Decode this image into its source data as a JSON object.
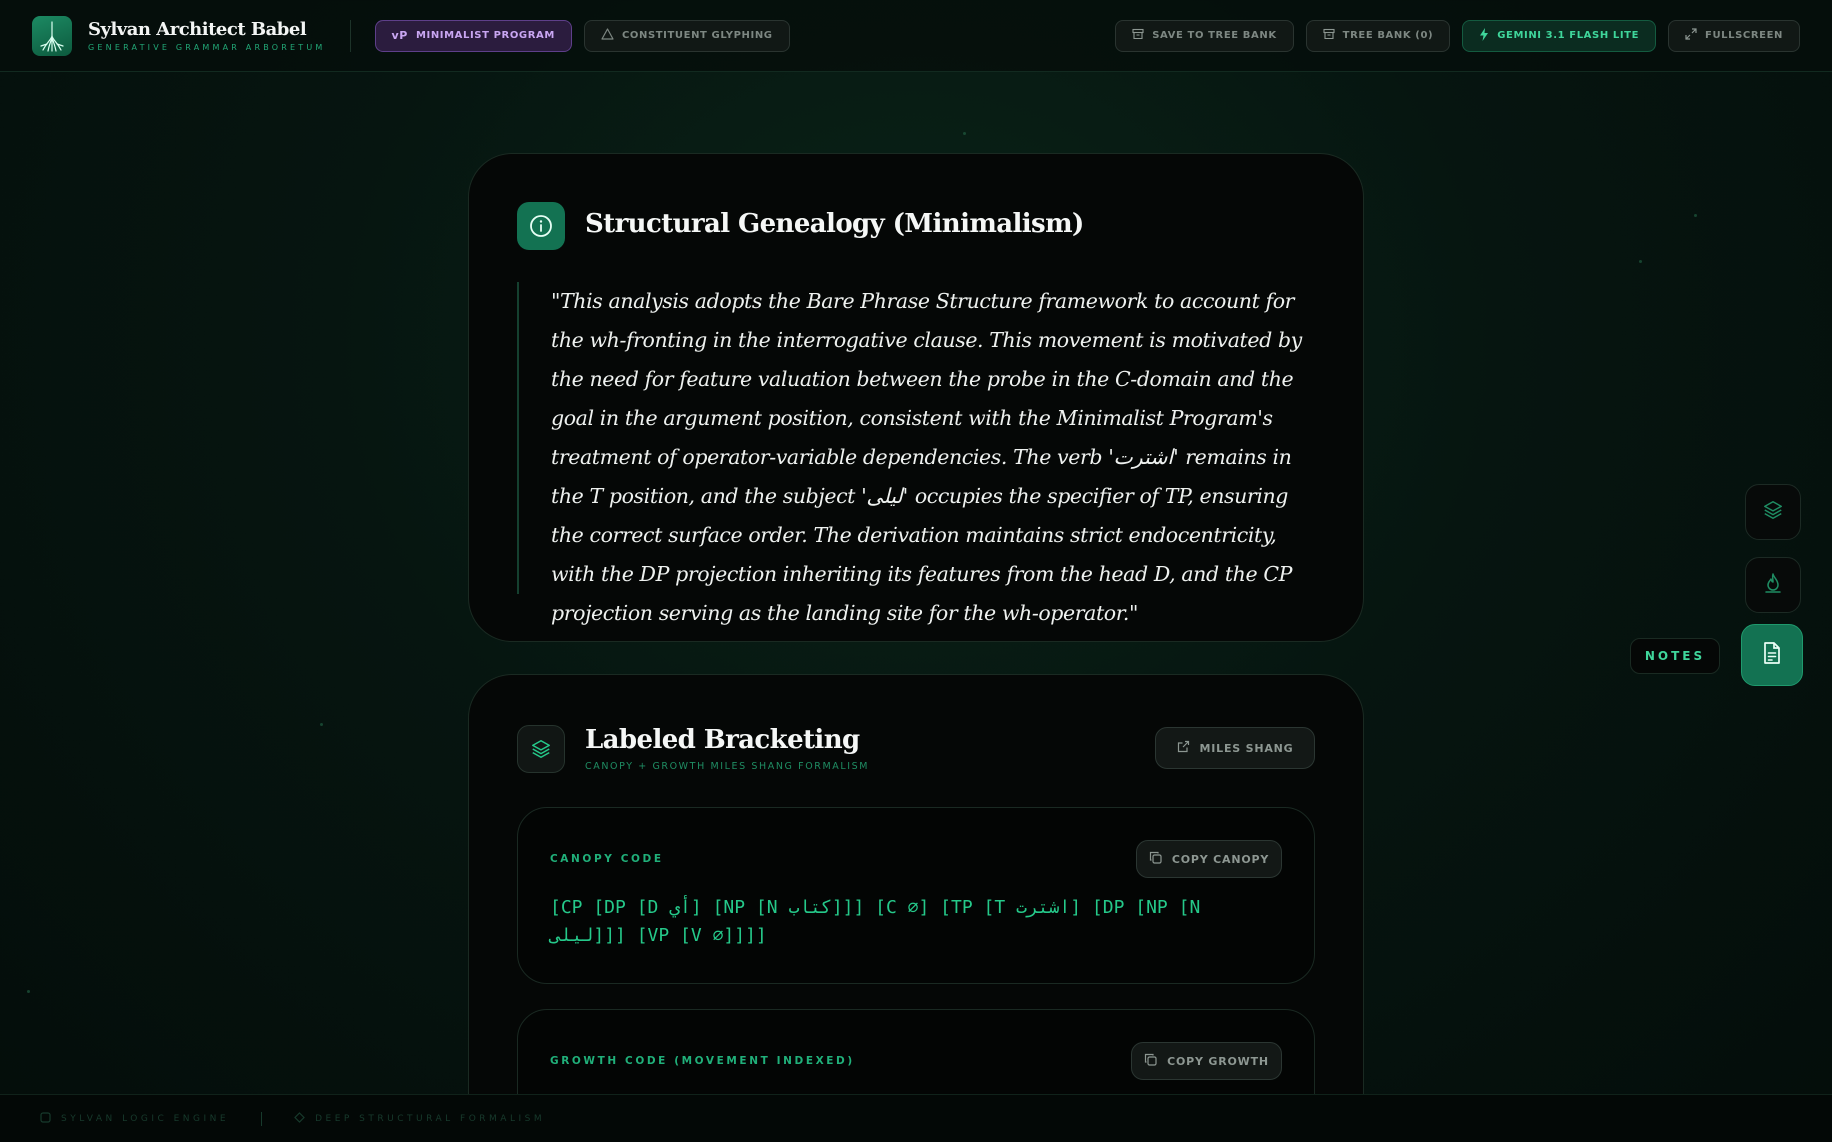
{
  "header": {
    "app_title": "Sylvan Architect Babel",
    "app_subtitle": "GENERATIVE GRAMMAR ARBORETUM",
    "mode_tabs": [
      {
        "tag": "vP",
        "label": "MINIMALIST PROGRAM"
      },
      {
        "label": "CONSTITUENT GLYPHING"
      }
    ],
    "actions": {
      "save": "SAVE TO TREE BANK",
      "bank": "TREE BANK (0)",
      "model": "GEMINI 3.1 FLASH LITE",
      "fullscreen": "FULLSCREEN"
    }
  },
  "genealogy": {
    "title": "Structural Genealogy (Minimalism)",
    "quote": "\"This analysis adopts the Bare Phrase Structure framework to account for the wh-fronting in the interrogative clause. This movement is motivated by the need for feature valuation between the probe in the C-domain and the goal in the argument position, consistent with the Minimalist Program's treatment of operator-variable dependencies. The verb 'اشترت' remains in the T position, and the subject 'ليلى' occupies the specifier of TP, ensuring the correct surface order. The derivation maintains strict endocentricity, with the DP projection inheriting its features from the head D, and the CP projection serving as the landing site for the wh-operator.\""
  },
  "bracketing": {
    "title": "Labeled Bracketing",
    "subtitle": "CANOPY + GROWTH MILES SHANG FORMALISM",
    "miles_button": "MILES SHANG",
    "canopy": {
      "label": "CANOPY CODE",
      "copy_label": "COPY CANOPY",
      "code": "[CP [DP [D أي] [NP [N كتاب]]] [C ∅] [TP [T اشترت] [DP [NP [N ليلى]]] [VP [V ∅]]]]"
    },
    "growth": {
      "label": "GROWTH CODE (MOVEMENT INDEXED)",
      "copy_label": "COPY GROWTH"
    }
  },
  "rail": {
    "tooltip": "NOTES",
    "buttons": [
      "layers-icon",
      "flame-icon",
      "notes-icon"
    ]
  },
  "footer": {
    "left": "SYLVAN LOGIC ENGINE",
    "middle": "DEEP STRUCTURAL FORMALISM"
  },
  "colors": {
    "accent": "#25c98a",
    "accent_dark": "#137252",
    "purple": "#c9a6f2",
    "background": "#061510"
  }
}
